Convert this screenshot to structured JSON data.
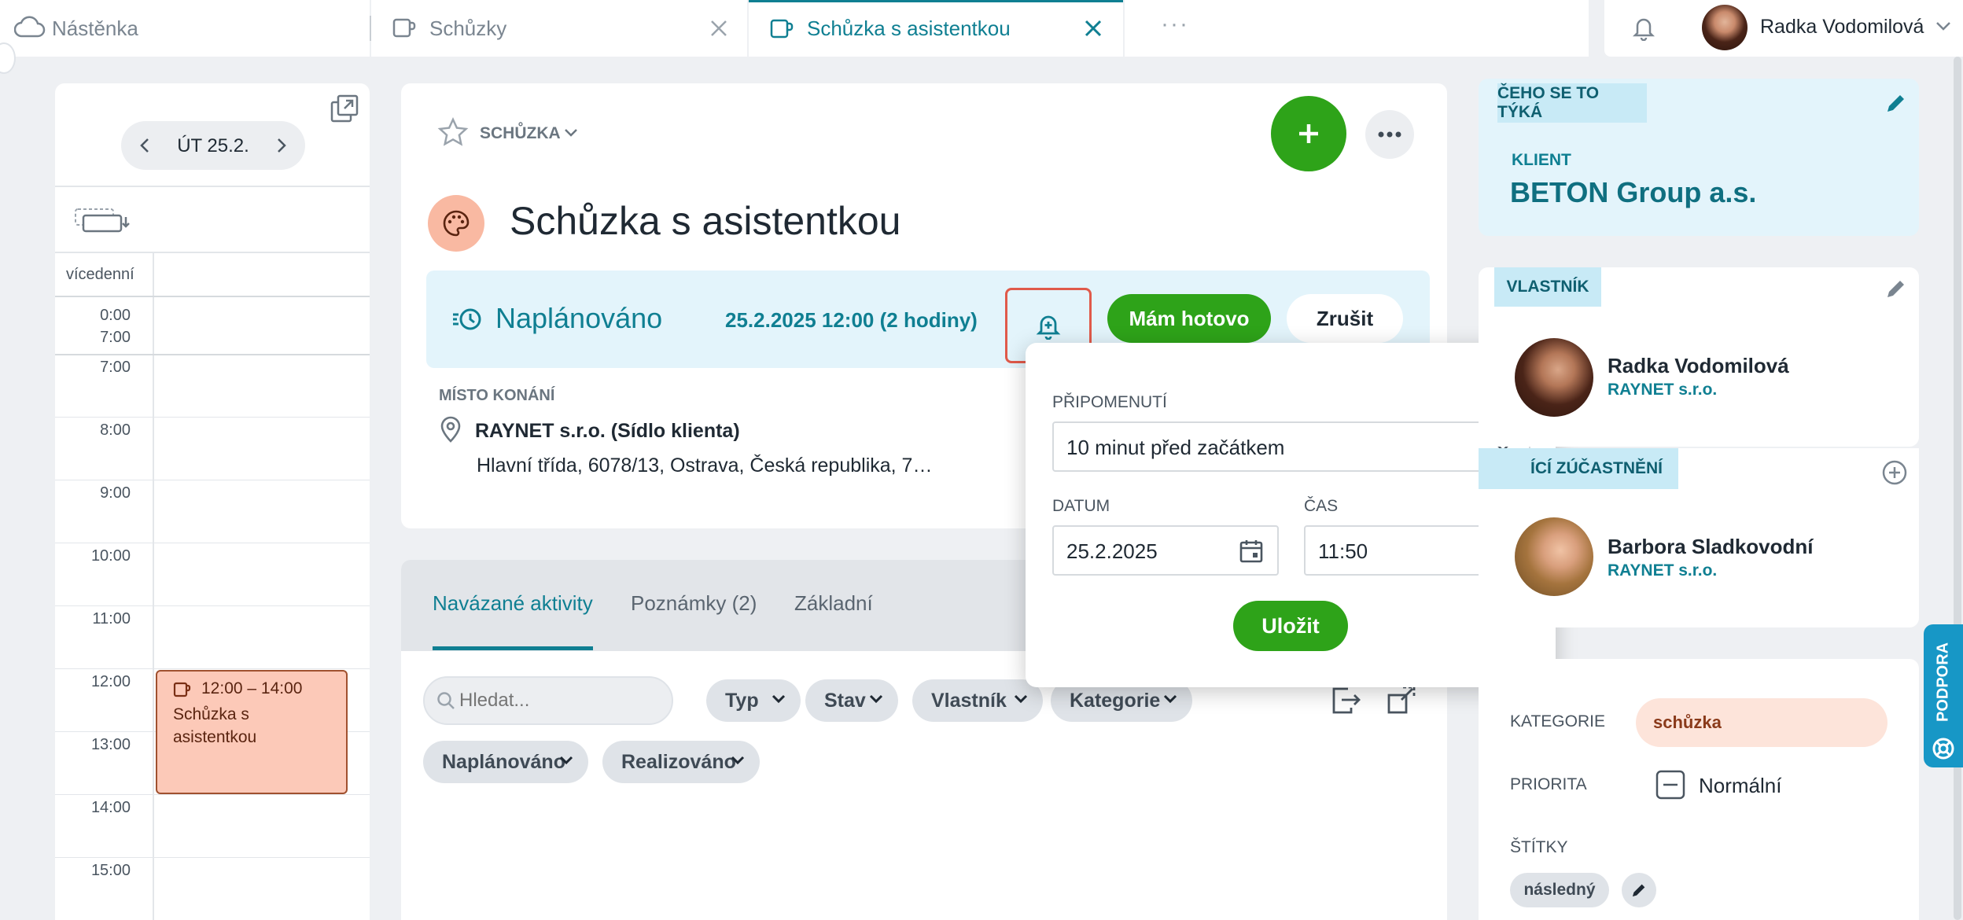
{
  "tabs": [
    {
      "label": "Nástěnka",
      "icon": "cloud-icon"
    },
    {
      "label": "Schůzky",
      "icon": "meeting-icon"
    },
    {
      "label": "Schůzka s asistentkou",
      "icon": "meeting-icon",
      "active": true
    },
    {
      "label": "···"
    }
  ],
  "user": {
    "name": "Radka Vodomilová"
  },
  "calendar": {
    "date_label": "ÚT 25.2.",
    "multiday_label": "vícedenní",
    "allday_times": [
      "0:00",
      "7:00"
    ],
    "hours": [
      "7:00",
      "8:00",
      "9:00",
      "10:00",
      "11:00",
      "12:00",
      "13:00",
      "14:00",
      "15:00"
    ],
    "event": {
      "time": "12:00 – 14:00",
      "title": "Schůzka s asistentkou"
    }
  },
  "detail": {
    "type_label": "SCHŮZKA",
    "title": "Schůzka s asistentkou",
    "status": "Naplánováno",
    "datetime": "25.2.2025 12:00 (2 hodiny)",
    "done_button": "Mám hotovo",
    "cancel_button": "Zrušit",
    "place_label": "MÍSTO KONÁNÍ",
    "place_name": "RAYNET s.r.o. (Sídlo klienta)",
    "place_address": "Hlavní třída, 6078/13, Ostrava, Česká republika, 7…"
  },
  "activities": {
    "tabs": [
      "Navázané aktivity",
      "Poznámky (2)",
      "Základní"
    ],
    "search_placeholder": "Hledat...",
    "filters_row1": [
      "Typ",
      "Stav",
      "Vlastník",
      "Kategorie"
    ],
    "filters_row2": [
      "Naplánováno",
      "Realizováno"
    ]
  },
  "reminder_popup": {
    "label": "PŘIPOMENUTÍ",
    "selected": "10 minut před začátkem",
    "date_label": "DATUM",
    "date_value": "25.2.2025",
    "time_label": "ČAS",
    "time_value": "11:50",
    "save_button": "Uložit"
  },
  "sidebar": {
    "about_label": "ČEHO SE TO TÝKÁ",
    "client_label": "KLIENT",
    "client_name": "BETON Group a.s.",
    "owner_label": "VLASTNÍK",
    "owner_name": "Radka Vodomilová",
    "owner_company": "RAYNET s.r.o.",
    "participants_label": "ÍCÍ ZÚČASTNĚNÍ",
    "participant_name": "Barbora Sladkovodní",
    "participant_company": "RAYNET s.r.o.",
    "category_label": "KATEGORIE",
    "category_value": "schůzka",
    "priority_label": "PRIORITA",
    "priority_value": "Normální",
    "tags_label": "ŠTÍTKY",
    "tag": "následný"
  },
  "support_label": "PODPORA",
  "colors": {
    "accent": "#0f7f92",
    "green": "#2ea319",
    "light_blue": "#e3f4fb",
    "alert_red": "#e05a4a"
  }
}
